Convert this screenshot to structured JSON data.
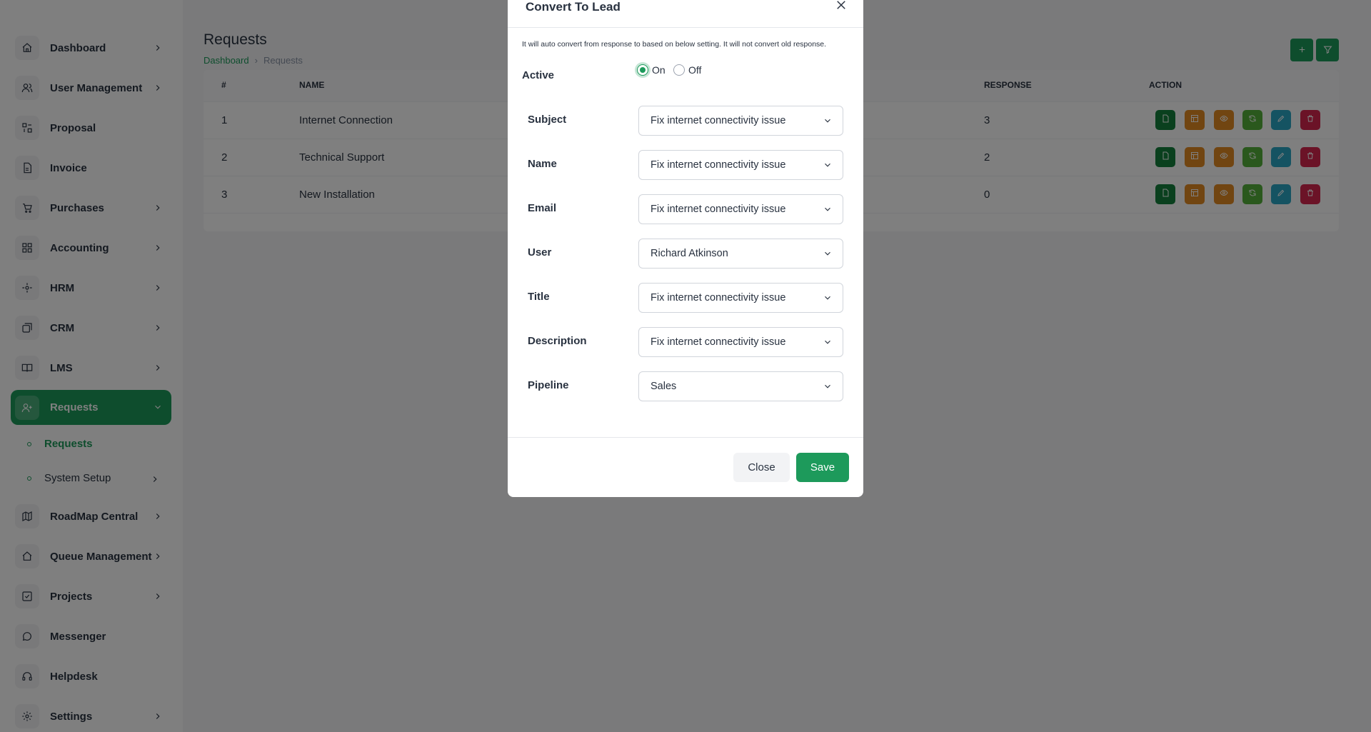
{
  "sidebar": {
    "items": [
      {
        "label": "Dashboard",
        "icon": "home-icon"
      },
      {
        "label": "User Management",
        "icon": "users-icon"
      },
      {
        "label": "Proposal",
        "icon": "proposal-icon"
      },
      {
        "label": "Invoice",
        "icon": "file-icon"
      },
      {
        "label": "Purchases",
        "icon": "cart-icon"
      },
      {
        "label": "Accounting",
        "icon": "grid-icon"
      },
      {
        "label": "HRM",
        "icon": "hrm-icon"
      },
      {
        "label": "CRM",
        "icon": "crm-icon"
      },
      {
        "label": "LMS",
        "icon": "book-icon"
      },
      {
        "label": "Requests",
        "icon": "user-plus-icon"
      },
      {
        "label": "RoadMap Central",
        "icon": "map-icon"
      },
      {
        "label": "Queue Management",
        "icon": "home-icon"
      },
      {
        "label": "Projects",
        "icon": "check-square-icon"
      },
      {
        "label": "Messenger",
        "icon": "message-icon"
      },
      {
        "label": "Helpdesk",
        "icon": "headset-icon"
      },
      {
        "label": "Settings",
        "icon": "gear-icon"
      }
    ],
    "sub_items": [
      {
        "label": "Requests"
      },
      {
        "label": "System Setup"
      }
    ]
  },
  "main": {
    "title": "Requests",
    "breadcrumb": {
      "home": "Dashboard",
      "sep": "›",
      "current": "Requests"
    },
    "table": {
      "headers": {
        "num": "#",
        "name": "NAME",
        "response": "RESPONSE",
        "action": "ACTION"
      },
      "rows": [
        {
          "num": "1",
          "name": "Internet Connection",
          "response": "3"
        },
        {
          "num": "2",
          "name": "Technical Support",
          "response": "2"
        },
        {
          "num": "3",
          "name": "New Installation",
          "response": "0"
        }
      ]
    }
  },
  "modal": {
    "title": "Convert To Lead",
    "note": "It will auto convert from response to based on below setting. It will not convert old response.",
    "active_label": "Active",
    "radio_on": "On",
    "radio_off": "Off",
    "active_value": "On",
    "fields": [
      {
        "label": "Subject",
        "value": "Fix internet connectivity issue"
      },
      {
        "label": "Name",
        "value": "Fix internet connectivity issue"
      },
      {
        "label": "Email",
        "value": "Fix internet connectivity issue"
      },
      {
        "label": "User",
        "value": "Richard Atkinson"
      },
      {
        "label": "Title",
        "value": "Fix internet connectivity issue"
      },
      {
        "label": "Description",
        "value": "Fix internet connectivity issue"
      },
      {
        "label": "Pipeline",
        "value": "Sales"
      }
    ],
    "close_label": "Close",
    "save_label": "Save"
  },
  "colors": {
    "accent": "#1d9a5b",
    "action_dark_green": "#15803d",
    "action_orange": "#e38b22",
    "action_light_green": "#55b13a",
    "action_teal": "#2aa6c4",
    "action_red": "#d6264f"
  }
}
